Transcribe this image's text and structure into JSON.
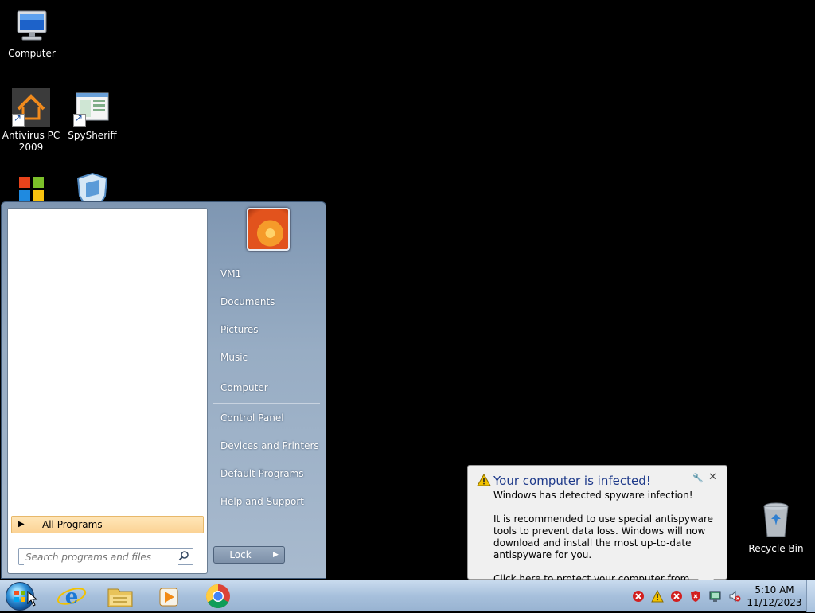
{
  "desktop": {
    "icons": [
      {
        "label": "Computer",
        "icon": "computer-icon"
      },
      {
        "label": "Antivirus PC\n2009",
        "icon": "antivirus-pc-icon"
      },
      {
        "label": "SpySheriff",
        "icon": "spysheriff-icon"
      },
      {
        "label": "",
        "icon": "windows-flag-icon"
      },
      {
        "label": "",
        "icon": "shield-icon"
      },
      {
        "label": "Recycle Bin",
        "icon": "recycle-bin-icon"
      }
    ]
  },
  "start_menu": {
    "all_programs": "All Programs",
    "search_placeholder": "Search programs and files",
    "user_items": [
      "VM1",
      "Documents",
      "Pictures",
      "Music"
    ],
    "system_items": [
      "Computer"
    ],
    "settings_items": [
      "Control Panel",
      "Devices and Printers",
      "Default Programs",
      "Help and Support"
    ],
    "lock_label": "Lock"
  },
  "balloon": {
    "title": "Your computer is infected!",
    "line1": "Windows has detected spyware infection!",
    "line2": "It is recommended to use special antispyware tools to prevent data loss. Windows will now download and install the most up-to-date antispyware for you.",
    "line3": "Click here to protect your computer from spyware!"
  },
  "taskbar": {
    "pinned": [
      "start-orb",
      "internet-explorer-icon",
      "file-explorer-icon",
      "media-player-icon",
      "chrome-icon"
    ],
    "tray": [
      "error-icon",
      "warning-icon",
      "error-icon",
      "shield-alert-icon",
      "network-icon",
      "speaker-muted-icon"
    ],
    "time": "5:10 AM",
    "date": "11/12/2023"
  },
  "colors": {
    "balloon_title": "#1e3a8a",
    "warning": "#f2c200",
    "error": "#d21f1f"
  }
}
